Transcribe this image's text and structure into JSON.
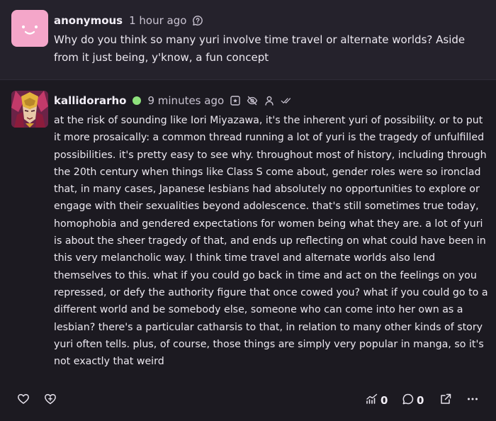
{
  "ask": {
    "username": "anonymous",
    "timestamp": "1 hour ago",
    "text": "Why do you think so many yuri involve time travel or alternate worlds? Aside from it just being, y'know, a fun concept",
    "icons": [
      "ask-bubble-icon"
    ]
  },
  "answer": {
    "username": "kallidorarho",
    "online_status_color": "#8ee07c",
    "timestamp": "9 minutes ago",
    "icons": [
      "embed-icon",
      "hidden-eye-icon",
      "person-icon",
      "double-check-icon"
    ],
    "text": "at the risk of sounding like Iori Miyazawa, it's the inherent yuri of possibility. or to put it more prosaically: a common thread running a lot of yuri is the tragedy of unfulfilled possibilities. it's pretty easy to see why. throughout most of history, including through the 20th century when things like Class S come about, gender roles were so ironclad that, in many cases, Japanese lesbians had absolutely no opportunities to explore or engage with their sexualities beyond adolescence. that's still sometimes true today, homophobia and gendered expectations for women being what they are. a lot of yuri is about the sheer tragedy of that, and ends up reflecting on what could have been in this very melancholic way. I think time travel and alternate worlds also lend themselves to this. what if you could go back in time and act on the feelings on you repressed, or defy the authority figure that once cowed you? what if you could go to a different world and be somebody else, someone who can come into her own as a lesbian? there's a particular catharsis to that, in relation to many other kinds of story yuri often tells. plus, of course, those things are simply very popular in manga, so it's not exactly that weird"
  },
  "actions": {
    "like_icon": "heart-icon",
    "boost_icon": "heart-shield-icon",
    "stats_icon": "stats-icon",
    "stats_count": "0",
    "comments_icon": "comment-icon",
    "comments_count": "0",
    "share_icon": "share-icon",
    "more_icon": "more-icon"
  },
  "colors": {
    "background": "#1c1a21",
    "ask_background": "#25222c",
    "ask_avatar": "#f4a6c9",
    "text": "#ece8f0",
    "muted": "#c9c3d1",
    "online": "#8ee07c"
  }
}
